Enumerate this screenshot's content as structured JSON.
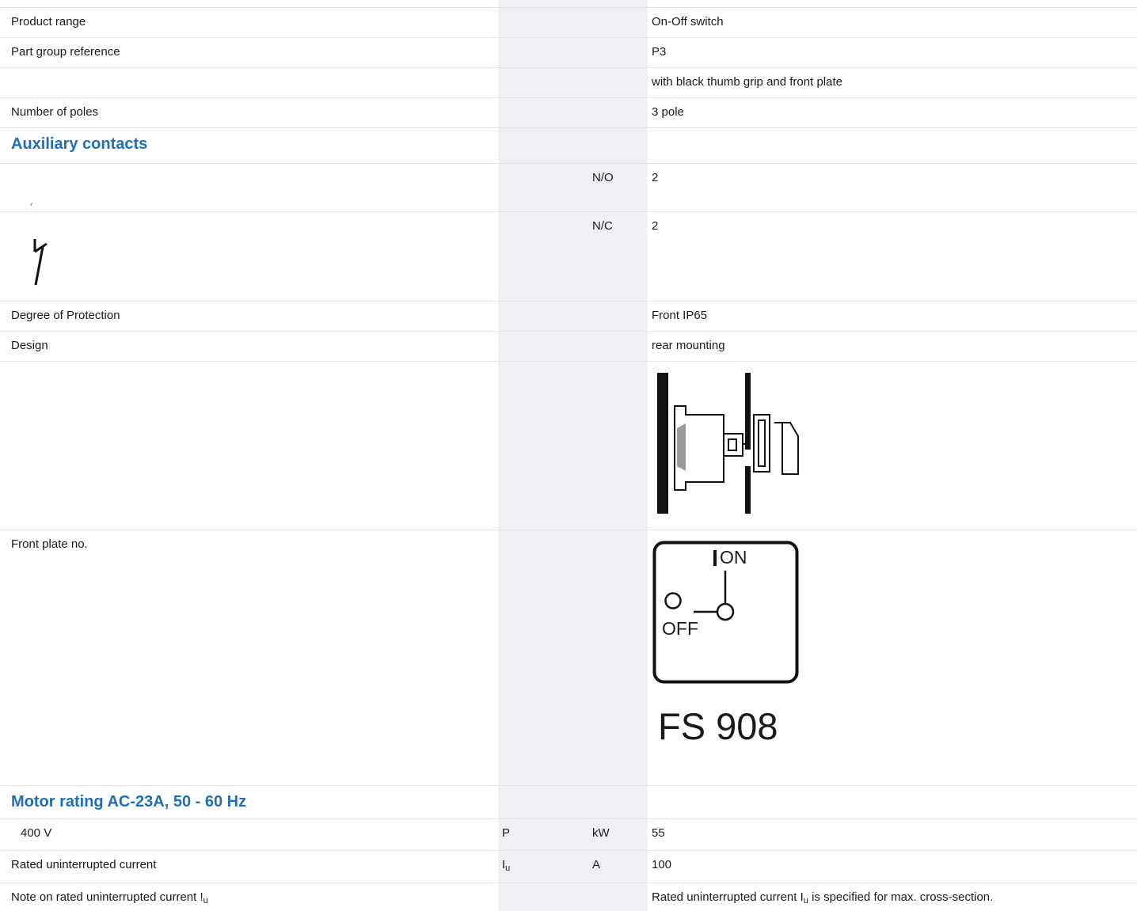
{
  "rows": {
    "product_range": {
      "label": "Product range",
      "value": "On-Off switch"
    },
    "part_group": {
      "label": "Part group reference",
      "value": "P3"
    },
    "grip": {
      "label": "",
      "value": "with black thumb grip and front plate"
    },
    "poles": {
      "label": "Number of poles",
      "value": "3 pole"
    },
    "aux_heading": "Auxiliary contacts",
    "no": {
      "unit": "N/O",
      "value": "2"
    },
    "nc": {
      "unit": "N/C",
      "value": "2"
    },
    "protection": {
      "label": "Degree of Protection",
      "value": "Front IP65"
    },
    "design": {
      "label": "Design",
      "value": "rear mounting"
    },
    "front_plate": {
      "label": "Front plate no.",
      "on": "ON",
      "off": "OFF",
      "code": "FS 908"
    },
    "motor_heading": "Motor rating AC-23A, 50 - 60 Hz",
    "motor_400": {
      "label": "400 V",
      "symbol": "P",
      "unit": "kW",
      "value": "55"
    },
    "rated": {
      "label": "Rated uninterrupted current",
      "symbol": "I",
      "symbol_sub": "u",
      "unit": "A",
      "value": "100"
    },
    "note": {
      "label": "Note on rated uninterrupted current !",
      "label_sub": "u",
      "value_pre": "Rated uninterrupted current I",
      "value_sub": "u",
      "value_post": " is specified for max. cross-section."
    }
  }
}
